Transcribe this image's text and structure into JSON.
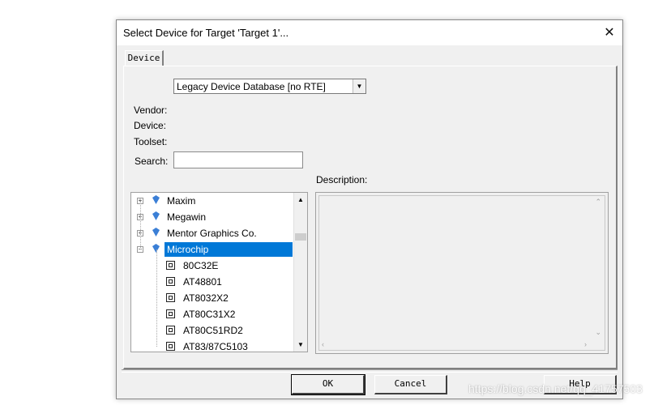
{
  "dialog": {
    "title": "Select Device for Target 'Target 1'...",
    "close_glyph": "✕"
  },
  "tabs": [
    {
      "label": "Device"
    }
  ],
  "database_select": {
    "value": "Legacy Device Database [no RTE]"
  },
  "fields": {
    "vendor_label": "Vendor:",
    "device_label": "Device:",
    "toolset_label": "Toolset:",
    "search_label": "Search:",
    "search_value": "",
    "description_label": "Description:"
  },
  "tree": {
    "items": [
      {
        "label": "Maxim",
        "kind": "vendor",
        "expanded": false
      },
      {
        "label": "Megawin",
        "kind": "vendor",
        "expanded": false
      },
      {
        "label": "Mentor Graphics Co.",
        "kind": "vendor",
        "expanded": false
      },
      {
        "label": "Microchip",
        "kind": "vendor",
        "expanded": true,
        "selected": true
      },
      {
        "label": "80C32E",
        "kind": "device"
      },
      {
        "label": "AT48801",
        "kind": "device"
      },
      {
        "label": "AT8032X2",
        "kind": "device"
      },
      {
        "label": "AT80C31X2",
        "kind": "device"
      },
      {
        "label": "AT80C51RD2",
        "kind": "device"
      },
      {
        "label": "AT83/87C5103",
        "kind": "device"
      }
    ]
  },
  "buttons": {
    "ok": "OK",
    "cancel": "Cancel",
    "help": "Help"
  },
  "watermark": "https://blog.csdn.net/qq_41757503",
  "colors": {
    "selection": "#0078d7",
    "dialog_bg": "#f0f0f0",
    "vendor_icon": "#3b7fd6"
  }
}
